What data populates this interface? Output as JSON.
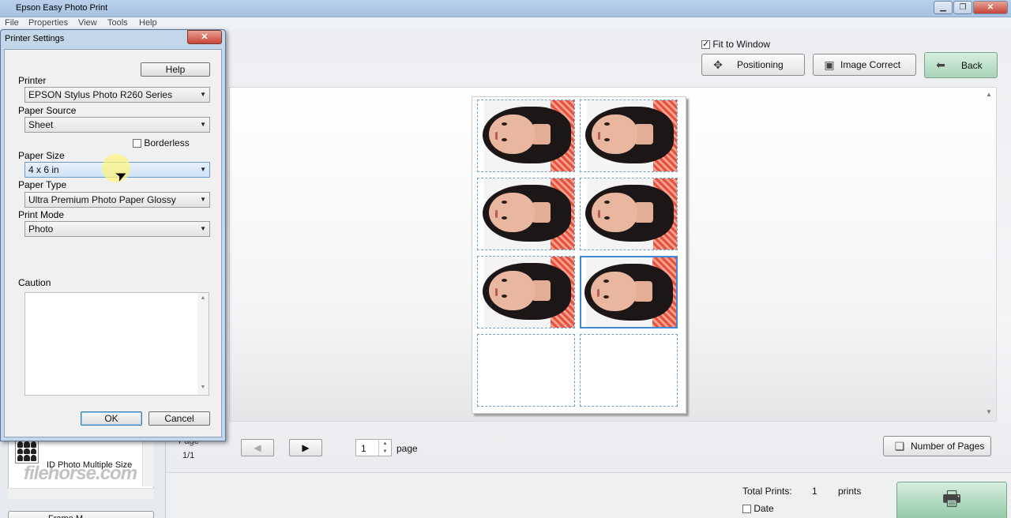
{
  "window": {
    "title": "Epson Easy Photo Print",
    "controls": {
      "minimize": "▁",
      "maximize": "❐",
      "close": "✕"
    }
  },
  "menu": [
    "File",
    "Properties",
    "View",
    "Tools",
    "Help"
  ],
  "toolbar": {
    "fit_to_window_label": "Fit to Window",
    "fit_to_window_checked": true,
    "positioning_label": "Positioning",
    "image_correct_label": "Image Correct",
    "back_label": "Back"
  },
  "pagination": {
    "page_label": "Page",
    "page_count": "1/1",
    "page_value": "1",
    "page_unit": "page",
    "prev_arrow": "◀",
    "next_arrow": "▶"
  },
  "number_of_pages_label": "Number of Pages",
  "totals": {
    "total_prints_label": "Total Prints:",
    "total_prints_value": "1",
    "total_prints_unit": "prints",
    "date_label": "Date",
    "date_checked": false
  },
  "left_panel": {
    "layout_label": "ID Photo Multiple Size",
    "bottom_label": "Frame M..."
  },
  "watermark": "filehorse.com",
  "dialog": {
    "title": "Printer Settings",
    "close": "✕",
    "help_label": "Help",
    "printer_label": "Printer",
    "printer_value": "EPSON Stylus Photo R260 Series",
    "paper_source_label": "Paper Source",
    "paper_source_value": "Sheet",
    "borderless_label": "Borderless",
    "borderless_checked": false,
    "paper_size_label": "Paper Size",
    "paper_size_value": "4 x 6 in",
    "paper_type_label": "Paper Type",
    "paper_type_value": "Ultra Premium Photo Paper Glossy",
    "print_mode_label": "Print Mode",
    "print_mode_value": "Photo",
    "caution_label": "Caution",
    "caution_text": "",
    "ok_label": "OK",
    "cancel_label": "Cancel"
  },
  "preview": {
    "cells": [
      {
        "filled": true,
        "selected": false
      },
      {
        "filled": true,
        "selected": false
      },
      {
        "filled": true,
        "selected": false
      },
      {
        "filled": true,
        "selected": false
      },
      {
        "filled": true,
        "selected": false
      },
      {
        "filled": true,
        "selected": true
      },
      {
        "filled": false,
        "selected": false
      },
      {
        "filled": false,
        "selected": false
      }
    ]
  }
}
